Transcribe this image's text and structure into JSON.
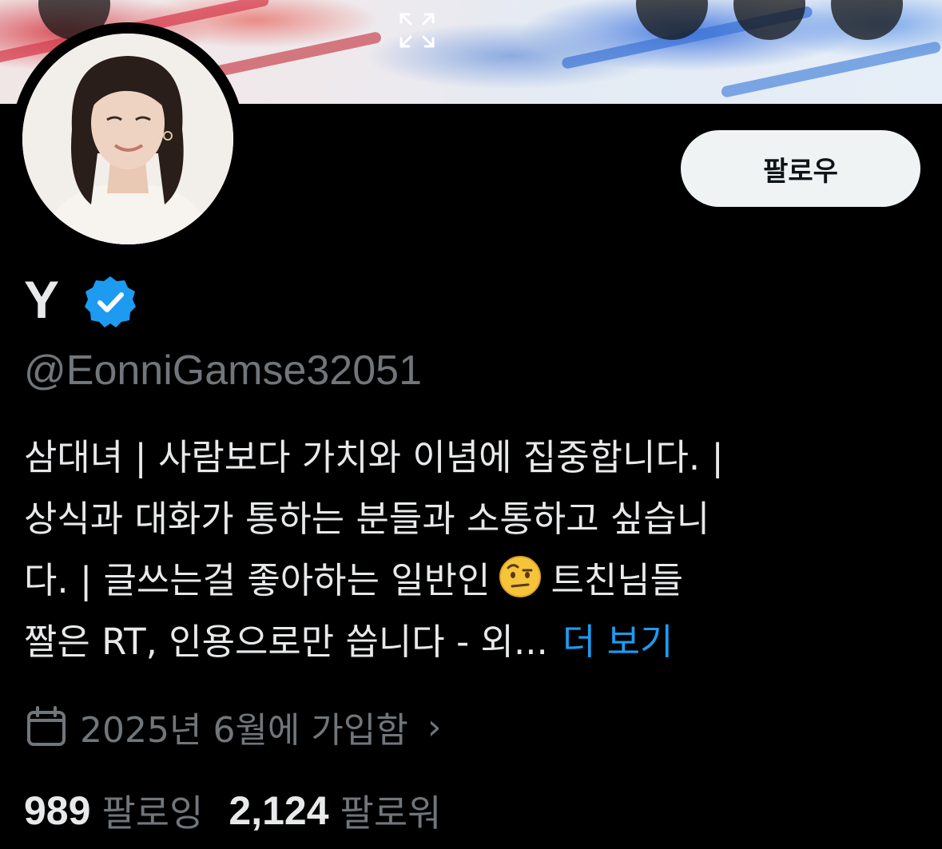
{
  "profile": {
    "display_name": "Y",
    "handle": "@EonniGamse32051",
    "follow_button_label": "팔로우",
    "bio_lines": [
      "삼대녀 | 사람보다 가치와 이념에 집중합니다. |",
      "상식과 대화가 통하는 분들과 소통하고 싶습니",
      "다. | 글쓰는걸 좋아하는 일반인",
      "트친님들",
      "짤은 RT, 인용으로만 씁니다 - 외...",
      "더 보기"
    ],
    "joined_text": "2025년 6월에 가입함",
    "following_count": "989",
    "following_label": "팔로잉",
    "followers_count": "2,124",
    "followers_label": "팔로워"
  },
  "icons": {
    "verified": "verified-badge-icon",
    "calendar": "calendar-icon",
    "chevron": "chevron-right-icon",
    "expand": "expand-icon",
    "emoji": "raised-eyebrow-emoji"
  },
  "colors": {
    "background": "#000000",
    "primary_text": "#e7e9ea",
    "secondary_text": "#71767b",
    "link": "#1d9bf0",
    "verified": "#1d9bf0",
    "follow_button_bg": "#eff3f4"
  }
}
